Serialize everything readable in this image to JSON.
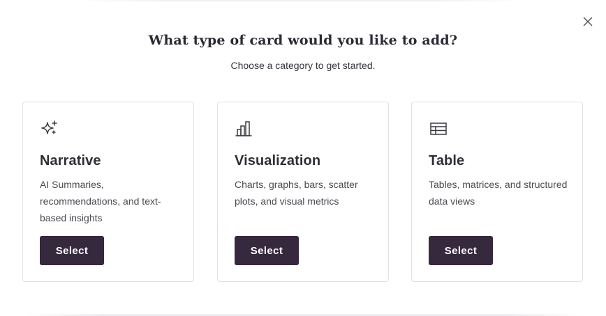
{
  "modal": {
    "title": "What type of card would you like to add?",
    "subtitle": "Choose a category to get started.",
    "close_icon": "close-icon"
  },
  "cards": [
    {
      "icon": "sparkles-icon",
      "title": "Narrative",
      "description": "AI Summaries, recommendations, and text-based insights",
      "button_label": "Select"
    },
    {
      "icon": "bar-chart-icon",
      "title": "Visualization",
      "description": "Charts, graphs, bars, scatter plots, and visual metrics",
      "button_label": "Select"
    },
    {
      "icon": "table-icon",
      "title": "Table",
      "description": "Tables, matrices, and structured data views",
      "button_label": "Select"
    }
  ],
  "colors": {
    "button_bg": "#36283d",
    "button_text": "#ffffff",
    "card_border": "#e1e1e6",
    "icon_stroke": "#3a3a42"
  }
}
